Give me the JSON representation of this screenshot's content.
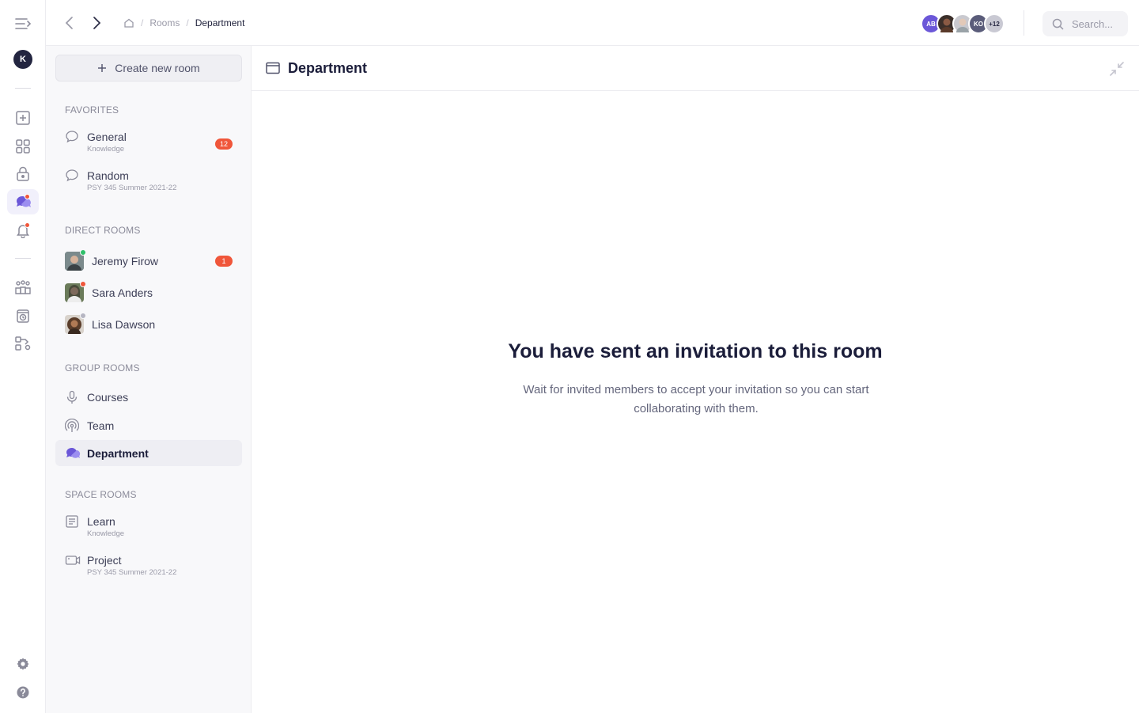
{
  "rail": {
    "user_initial": "K"
  },
  "topbar": {
    "breadcrumb": [
      "Rooms",
      "Department"
    ],
    "avatars": [
      {
        "initials": "AB",
        "color": "#6b57d8"
      },
      {
        "initials": "",
        "color": "#3b2f2a"
      },
      {
        "initials": "",
        "color": "#c9c9cf"
      },
      {
        "initials": "KO",
        "color": "#5a5c7a"
      },
      {
        "initials": "+12",
        "color": "#c9c9d3"
      }
    ],
    "search_placeholder": "Search..."
  },
  "sidebar": {
    "create_label": "Create new room",
    "favorites_title": "FAVORITES",
    "favorites": [
      {
        "name": "General",
        "sub": "Knowledge",
        "badge": "12"
      },
      {
        "name": "Random",
        "sub": "PSY 345 Summer 2021-22"
      }
    ],
    "direct_title": "DIRECT ROOMS",
    "direct": [
      {
        "name": "Jeremy Firow",
        "badge": "1",
        "status": "#2fbf6a"
      },
      {
        "name": "Sara Anders",
        "status": "#f0563a"
      },
      {
        "name": "Lisa Dawson",
        "status": "#b6b6c2"
      }
    ],
    "group_title": "GROUP ROOMS",
    "group": [
      {
        "name": "Courses"
      },
      {
        "name": "Team"
      },
      {
        "name": "Department"
      }
    ],
    "space_title": "SPACE ROOMS",
    "space": [
      {
        "name": "Learn",
        "sub": "Knowledge"
      },
      {
        "name": "Project",
        "sub": "PSY 345 Summer 2021-22"
      }
    ]
  },
  "main": {
    "title": "Department",
    "empty_title": "You have sent an invitation to this room",
    "empty_desc": "Wait for invited members to accept your invitation so you can start collaborating with them."
  },
  "colors": {
    "accent": "#6b57d8",
    "badge": "#f0563a"
  }
}
